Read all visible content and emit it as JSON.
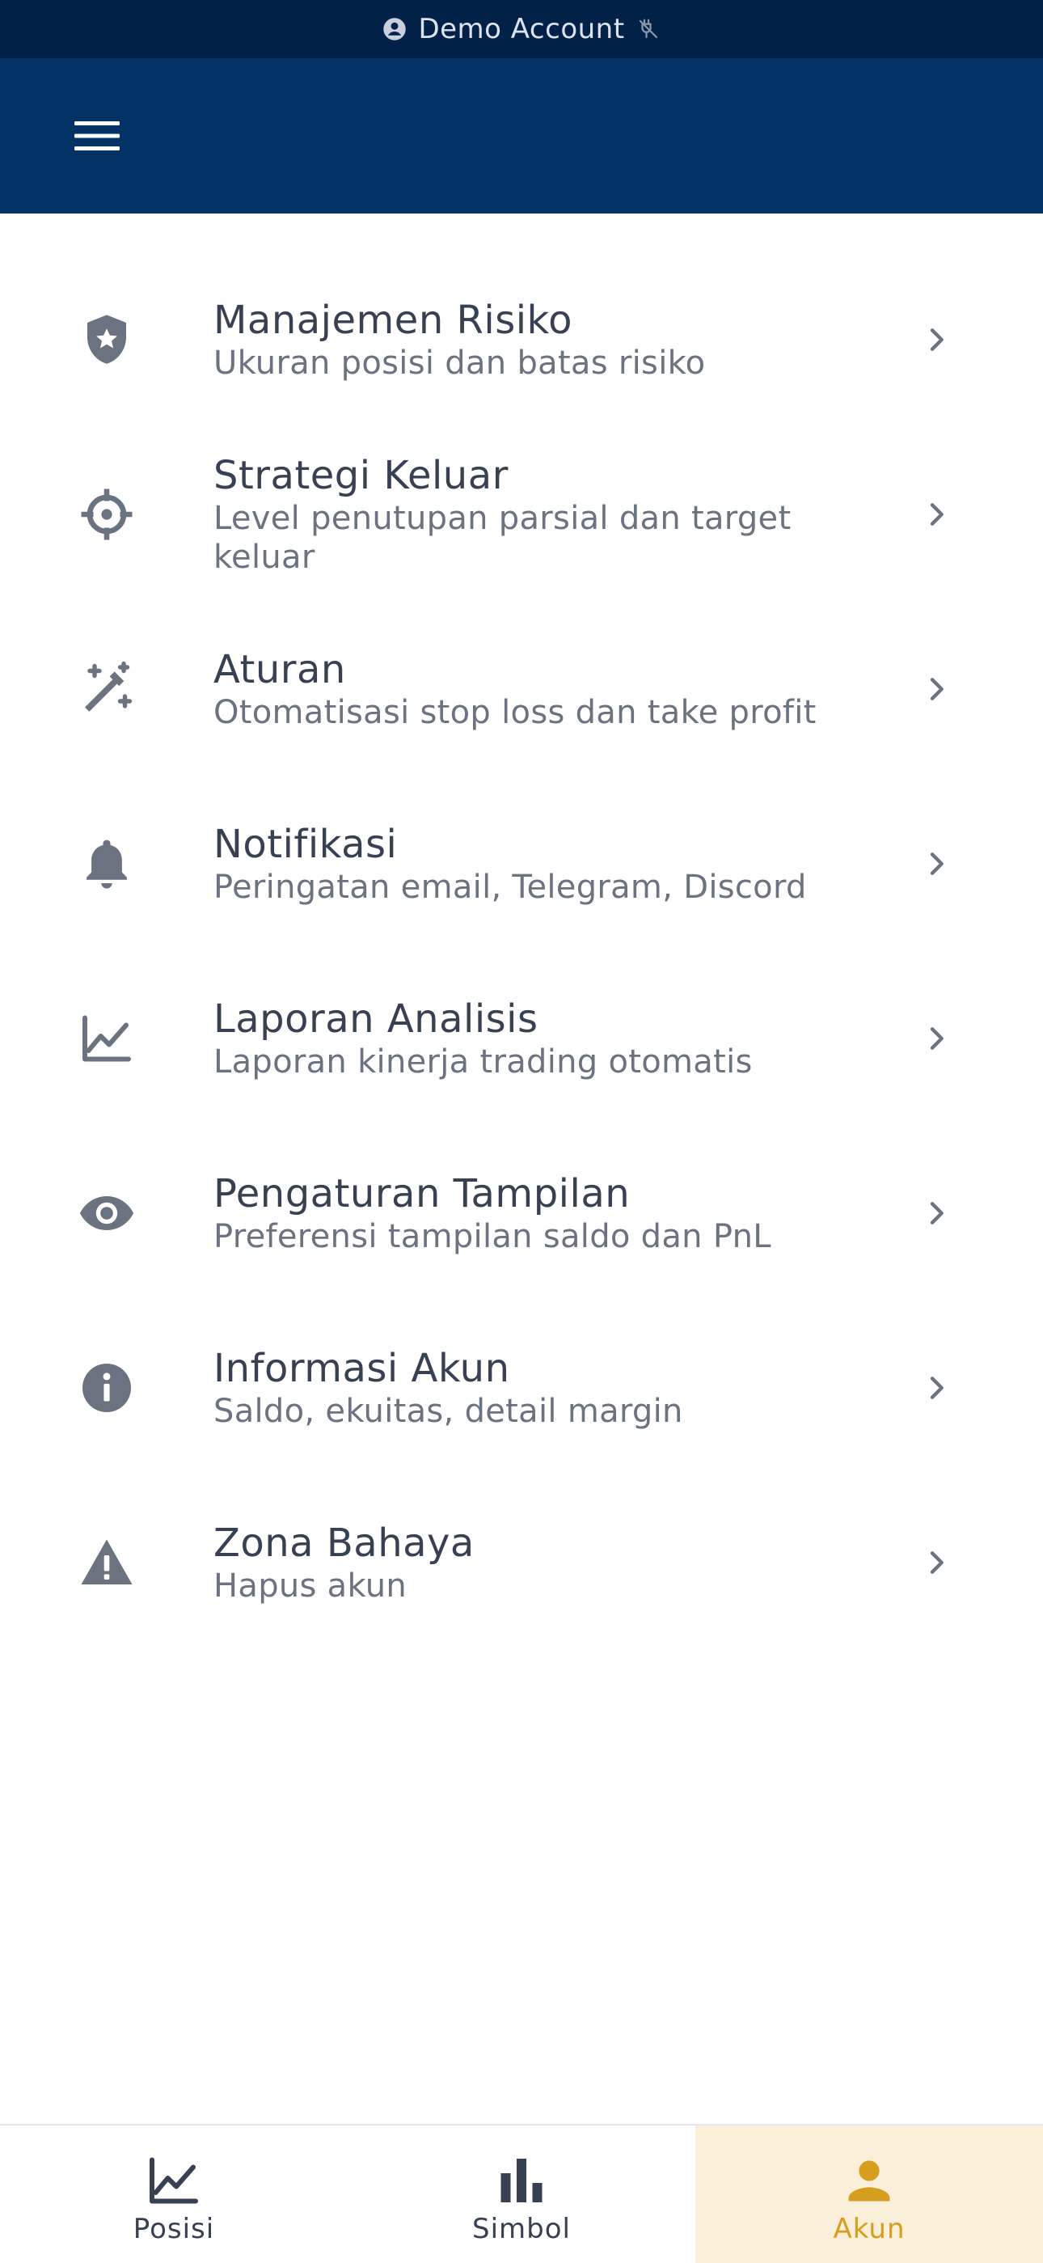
{
  "status_bar": {
    "account_label": "Demo Account",
    "icons": [
      "account-circle-icon",
      "disconnected-plug-icon"
    ]
  },
  "app_bar": {
    "menu_icon": "hamburger-menu-icon"
  },
  "menu": {
    "items": [
      {
        "title": "Manajemen Risiko",
        "subtitle": "Ukuran posisi dan batas risiko",
        "icon": "shield-star-icon"
      },
      {
        "title": "Strategi Keluar",
        "subtitle": "Level penutupan parsial dan target keluar",
        "icon": "crosshair-icon"
      },
      {
        "title": "Aturan",
        "subtitle": "Otomatisasi stop loss dan take profit",
        "icon": "magic-wand-icon"
      },
      {
        "title": "Notifikasi",
        "subtitle": "Peringatan email, Telegram, Discord",
        "icon": "bell-icon"
      },
      {
        "title": "Laporan Analisis",
        "subtitle": "Laporan kinerja trading otomatis",
        "icon": "line-chart-icon"
      },
      {
        "title": "Pengaturan Tampilan",
        "subtitle": "Preferensi tampilan saldo dan PnL",
        "icon": "eye-icon"
      },
      {
        "title": "Informasi Akun",
        "subtitle": "Saldo, ekuitas, detail margin",
        "icon": "info-icon"
      },
      {
        "title": "Zona Bahaya",
        "subtitle": "Hapus akun",
        "icon": "warning-icon"
      }
    ]
  },
  "bottom_nav": {
    "tabs": [
      {
        "label": "Posisi",
        "icon": "line-chart-icon",
        "active": false
      },
      {
        "label": "Simbol",
        "icon": "bar-chart-icon",
        "active": false
      },
      {
        "label": "Akun",
        "icon": "person-icon",
        "active": true
      }
    ]
  },
  "colors": {
    "status_bar_bg": "#022148",
    "app_bar_bg": "#033266",
    "icon_gray": "#6b7280",
    "title_text": "#374151",
    "subtitle_text": "#6b7280",
    "accent": "#d69e1e",
    "active_tab_bg": "#faefd8"
  }
}
